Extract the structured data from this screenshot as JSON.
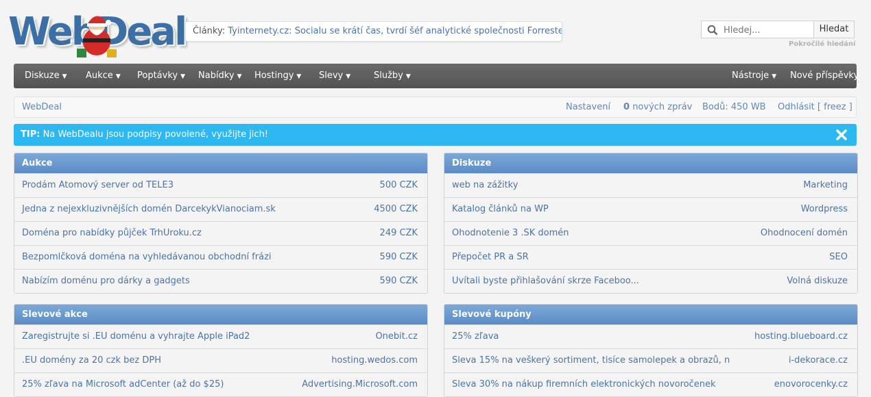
{
  "header": {
    "logo_text": "WebDeal",
    "news_label": "Články:",
    "news_text": "Tyinternety.cz: Socialu se krátí čas, tvrdí šéf analytické společnosti Forrester...",
    "search_placeholder": "Hledej...",
    "search_button": "Hledat",
    "advanced_search": "Pokročilé hledání"
  },
  "nav": {
    "left": [
      {
        "label": "Diskuze"
      },
      {
        "label": "Aukce"
      },
      {
        "label": "Poptávky"
      },
      {
        "label": "Nabídky"
      },
      {
        "label": "Hostingy"
      },
      {
        "label": "Slevy"
      },
      {
        "label": "Služby"
      }
    ],
    "tools": "Nástroje",
    "new_posts": "Nové příspěvky",
    "arrow": "▼"
  },
  "status": {
    "home": "WebDeal",
    "settings": "Nastavení",
    "msg_count": "0",
    "msg_label": "nových zpráv",
    "points": "Bodů: 450 WB",
    "logout": "Odhlásit [ freez ]"
  },
  "tip": {
    "label": "TIP:",
    "text": "Na WebDealu jsou podpisy povolené, využijte jich!"
  },
  "panels": {
    "aukce": {
      "title": "Aukce",
      "rows": [
        {
          "l": "Prodám Atomový server od TELE3",
          "r": "500 CZK"
        },
        {
          "l": "Jedna z nejexkluzivnějších domén DarcekykVianociam.sk",
          "r": "4500 CZK"
        },
        {
          "l": "Doména pro nabídky půjček TrhUroku.cz",
          "r": "249 CZK"
        },
        {
          "l": "Bezpomlčková doména na vyhledávanou obchodní frázi",
          "r": "590 CZK"
        },
        {
          "l": "Nabízím doménu pro dárky a gadgets",
          "r": "590 CZK"
        }
      ]
    },
    "diskuze": {
      "title": "Diskuze",
      "rows": [
        {
          "l": "web na zážitky",
          "r": "Marketing"
        },
        {
          "l": "Katalog článků na WP",
          "r": "Wordpress"
        },
        {
          "l": "Ohodnotenie 3 .SK domén",
          "r": "Ohodnocení domén"
        },
        {
          "l": "Přepočet PR a SR",
          "r": "SEO"
        },
        {
          "l": "Uvítali byste přihlašování skrze Faceboo...",
          "r": "Volná diskuze"
        }
      ]
    },
    "slevove_akce": {
      "title": "Slevové akce",
      "rows": [
        {
          "l": "Zaregistrujte si .EU doménu a vyhrajte Apple iPad2",
          "r": "Onebit.cz"
        },
        {
          "l": ".EU domény za 20 czk bez DPH",
          "r": "hosting.wedos.com"
        },
        {
          "l": "25% zľava na Microsoft adCenter (až do $25)",
          "r": "Advertising.Microsoft.com"
        }
      ]
    },
    "slevove_kupony": {
      "title": "Slevové kupóny",
      "rows": [
        {
          "l": "25% zľava",
          "r": "hosting.blueboard.cz"
        },
        {
          "l": "Sleva 15% na veškerý sortiment, tisíce samolepek a obrazů, n",
          "r": "i-dekorace.cz"
        },
        {
          "l": "Sleva 30% na nákup firemních elektronických novoročenek",
          "r": "enovorocenky.cz"
        }
      ]
    }
  }
}
